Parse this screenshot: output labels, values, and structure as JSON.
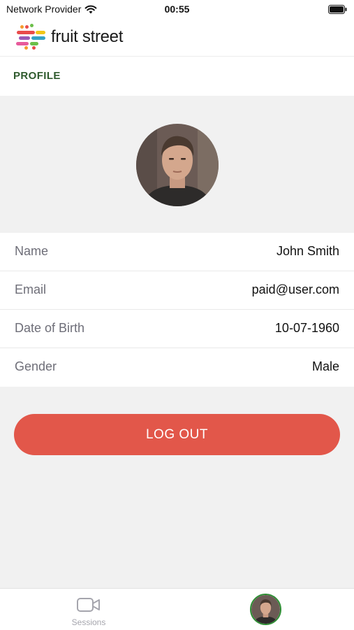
{
  "status_bar": {
    "carrier": "Network Provider",
    "time": "00:55"
  },
  "header": {
    "app_name": "fruit street",
    "logo_colors": [
      "#e94b4b",
      "#f59a2e",
      "#f2c617",
      "#6cbf4a",
      "#36a3c6",
      "#9b59b6",
      "#e75a9b"
    ]
  },
  "profile": {
    "section_title": "PROFILE",
    "fields": [
      {
        "label": "Name",
        "value": "John Smith"
      },
      {
        "label": "Email",
        "value": "paid@user.com"
      },
      {
        "label": "Date of Birth",
        "value": "10-07-1960"
      },
      {
        "label": "Gender",
        "value": "Male"
      }
    ],
    "logout_label": "LOG OUT"
  },
  "tab_bar": {
    "items": [
      {
        "label": "Sessions",
        "icon": "video-camera-icon"
      },
      {
        "label": "",
        "icon": "profile-avatar"
      }
    ]
  },
  "colors": {
    "accent_green": "#2f5a2d",
    "logout_red": "#e2574a",
    "avatar_ring": "#2f8f35",
    "background": "#f1f1f1"
  }
}
